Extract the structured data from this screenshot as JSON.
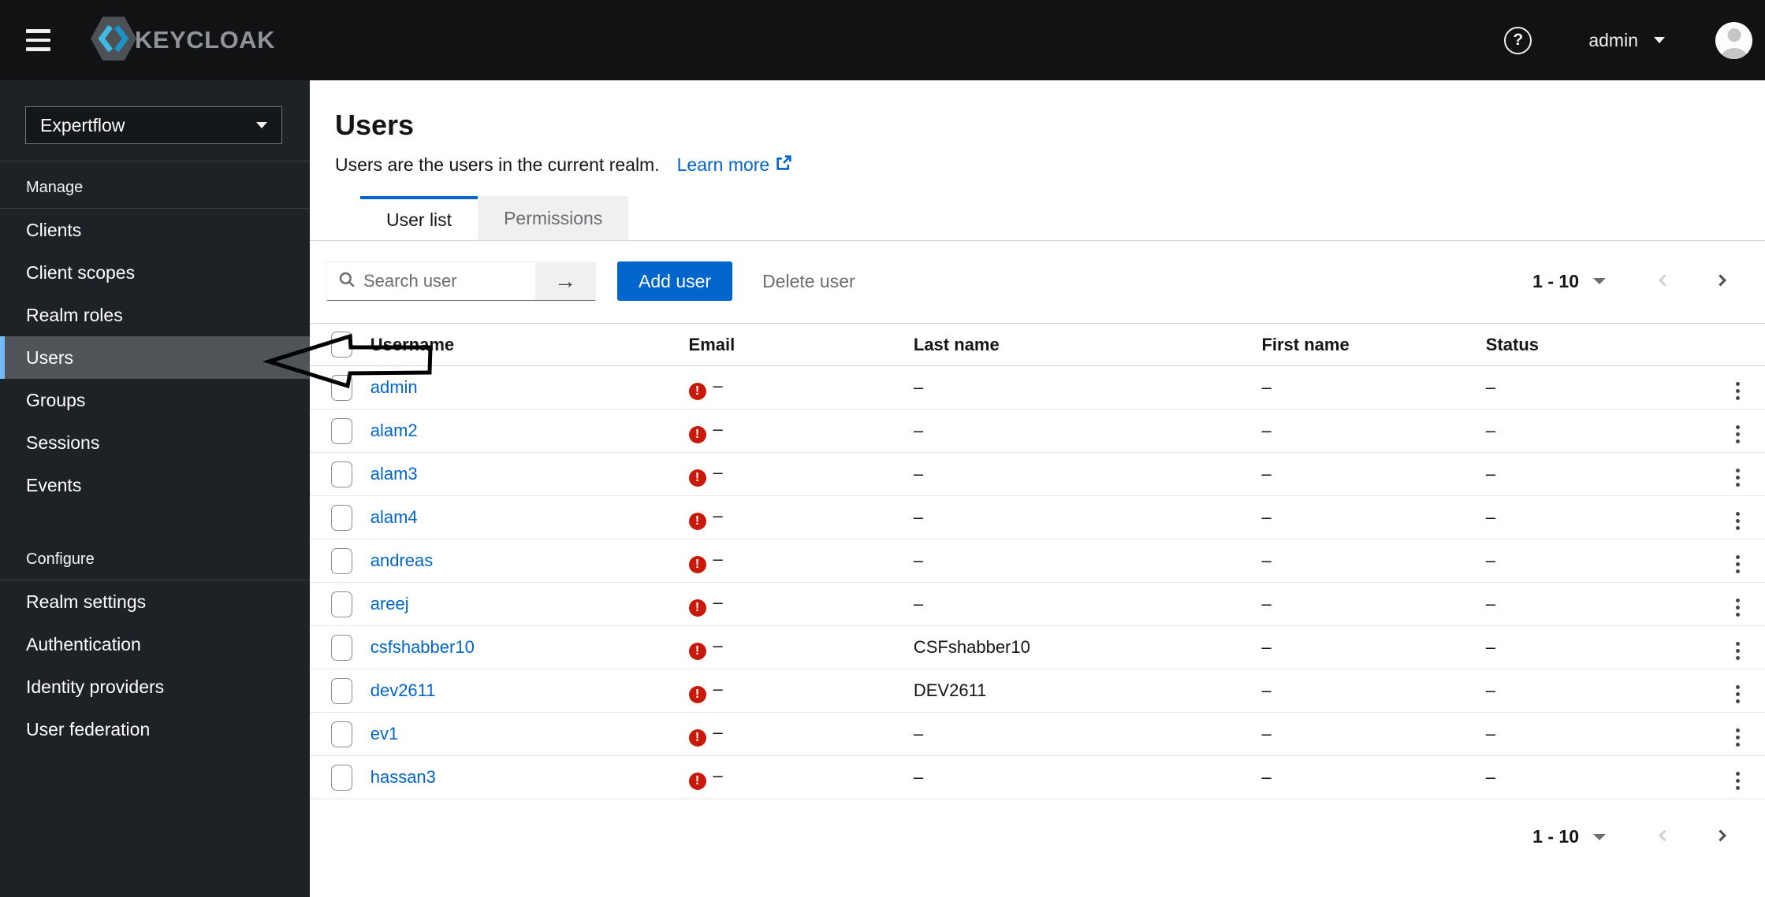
{
  "masthead": {
    "brand_text": "KEYCLOAK",
    "username": "admin"
  },
  "sidebar": {
    "realm": "Expertflow",
    "sections": [
      {
        "title": "Manage",
        "items": [
          "Clients",
          "Client scopes",
          "Realm roles",
          "Users",
          "Groups",
          "Sessions",
          "Events"
        ],
        "selected_item": "Users"
      },
      {
        "title": "Configure",
        "items": [
          "Realm settings",
          "Authentication",
          "Identity providers",
          "User federation"
        ]
      }
    ]
  },
  "page": {
    "title": "Users",
    "description": "Users are the users in the current realm.",
    "learn_more_label": "Learn more"
  },
  "tabs": [
    {
      "label": "User list",
      "active": true
    },
    {
      "label": "Permissions",
      "active": false
    }
  ],
  "toolbar": {
    "search_placeholder": "Search user",
    "add_user_label": "Add user",
    "delete_user_label": "Delete user"
  },
  "pagination": {
    "range": "1 - 10"
  },
  "table": {
    "columns": [
      "Username",
      "Email",
      "Last name",
      "First name",
      "Status"
    ],
    "empty_value": "–",
    "rows": [
      {
        "username": "admin",
        "email": "–",
        "last_name": "–",
        "first_name": "–",
        "status": "–"
      },
      {
        "username": "alam2",
        "email": "–",
        "last_name": "–",
        "first_name": "–",
        "status": "–"
      },
      {
        "username": "alam3",
        "email": "–",
        "last_name": "–",
        "first_name": "–",
        "status": "–"
      },
      {
        "username": "alam4",
        "email": "–",
        "last_name": "–",
        "first_name": "–",
        "status": "–"
      },
      {
        "username": "andreas",
        "email": "–",
        "last_name": "–",
        "first_name": "–",
        "status": "–"
      },
      {
        "username": "areej",
        "email": "–",
        "last_name": "–",
        "first_name": "–",
        "status": "–"
      },
      {
        "username": "csfshabber10",
        "email": "–",
        "last_name": "CSFshabber10",
        "first_name": "–",
        "status": "–"
      },
      {
        "username": "dev2611",
        "email": "–",
        "last_name": "DEV2611",
        "first_name": "–",
        "status": "–"
      },
      {
        "username": "ev1",
        "email": "–",
        "last_name": "–",
        "first_name": "–",
        "status": "–"
      },
      {
        "username": "hassan3",
        "email": "–",
        "last_name": "–",
        "first_name": "–",
        "status": "–"
      }
    ]
  },
  "colors": {
    "primary": "#0066cc",
    "error": "#c9190b",
    "nav_accent": "#73bcf7"
  }
}
